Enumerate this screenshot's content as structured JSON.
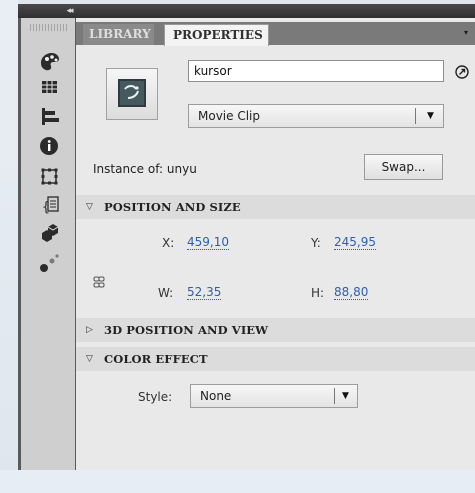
{
  "panel": {
    "collapse_icon": "◂◂",
    "tabs": [
      {
        "label": "LIBRARY"
      },
      {
        "label": "PROPERTIES"
      }
    ],
    "instance_name": "kursor",
    "symbol_type": "Movie Clip",
    "instance_of_label": "Instance of:",
    "instance_of_value": "unyu",
    "swap_label": "Swap...",
    "sections": {
      "position_size": "POSITION AND SIZE",
      "position_3d": "3D POSITION AND VIEW",
      "color_effect": "COLOR EFFECT"
    },
    "x_label": "X:",
    "x_value": "459,10",
    "y_label": "Y:",
    "y_value": "245,95",
    "w_label": "W:",
    "w_value": "52,35",
    "h_label": "H:",
    "h_value": "88,80",
    "style_label": "Style:",
    "style_value": "None"
  },
  "icons": [
    "palette-icon",
    "grid-icon",
    "align-icon",
    "info-icon",
    "transform-icon",
    "code-snippet-icon",
    "components-icon",
    "motion-presets-icon"
  ],
  "colors": {
    "link_value": "#2e5fae",
    "panel_bg": "#e9e9e9",
    "section_bg": "#dcdcdc",
    "toolbar_bg": "#cfcfcf"
  }
}
